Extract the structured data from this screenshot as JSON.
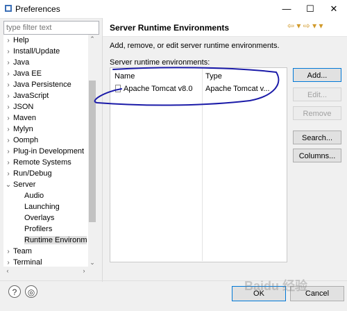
{
  "window": {
    "title": "Preferences",
    "minimize": "—",
    "maximize": "☐",
    "close": "✕"
  },
  "filter": {
    "placeholder": "type filter text"
  },
  "tree": [
    {
      "label": "Help",
      "chev": "›"
    },
    {
      "label": "Install/Update",
      "chev": "›"
    },
    {
      "label": "Java",
      "chev": "›"
    },
    {
      "label": "Java EE",
      "chev": "›"
    },
    {
      "label": "Java Persistence",
      "chev": "›"
    },
    {
      "label": "JavaScript",
      "chev": "›"
    },
    {
      "label": "JSON",
      "chev": "›"
    },
    {
      "label": "Maven",
      "chev": "›"
    },
    {
      "label": "Mylyn",
      "chev": "›"
    },
    {
      "label": "Oomph",
      "chev": "›"
    },
    {
      "label": "Plug-in Development",
      "chev": "›"
    },
    {
      "label": "Remote Systems",
      "chev": "›"
    },
    {
      "label": "Run/Debug",
      "chev": "›"
    },
    {
      "label": "Server",
      "chev": "⌄"
    },
    {
      "label": "Audio",
      "chev": "",
      "child": true
    },
    {
      "label": "Launching",
      "chev": "",
      "child": true
    },
    {
      "label": "Overlays",
      "chev": "",
      "child": true
    },
    {
      "label": "Profilers",
      "chev": "",
      "child": true
    },
    {
      "label": "Runtime Environm",
      "chev": "",
      "child": true,
      "selected": true
    },
    {
      "label": "Team",
      "chev": "›"
    },
    {
      "label": "Terminal",
      "chev": "›"
    }
  ],
  "page": {
    "title": "Server Runtime Environments",
    "description": "Add, remove, or edit server runtime environments.",
    "list_label": "Server runtime environments:",
    "nav": "⇦ ▾ ⇨ ▾ ▾"
  },
  "table": {
    "headers": [
      "Name",
      "Type"
    ],
    "rows": [
      {
        "name": "Apache Tomcat v8.0",
        "type": "Apache Tomcat v..."
      }
    ]
  },
  "buttons": {
    "add": "Add...",
    "edit": "Edit...",
    "remove": "Remove",
    "search": "Search...",
    "columns": "Columns..."
  },
  "footer": {
    "help": "?",
    "import": "◎",
    "ok": "OK",
    "cancel": "Cancel"
  },
  "watermark": "Baidu 经验",
  "colors": {
    "annotation": "#1a1aa8",
    "accent": "#0078d7"
  }
}
